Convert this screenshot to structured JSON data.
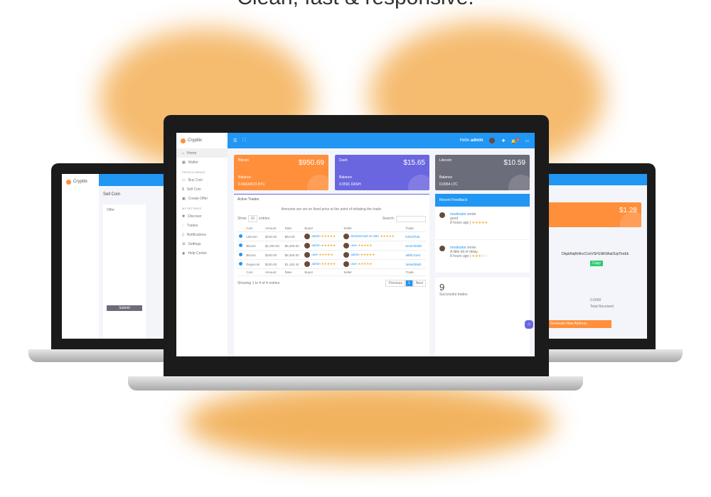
{
  "headline": "Clean, fast & responsive.",
  "colors": {
    "accent": "#2196f3",
    "orange": "#ff8f3a",
    "purple": "#6a66e0",
    "gray": "#6c6d7a"
  },
  "brand": "Cryptlix",
  "topbar": {
    "greeting": "Hello",
    "user": "admin",
    "notif_count": "1"
  },
  "sidebar": {
    "items": [
      {
        "label": "Home",
        "icon": "home-icon"
      },
      {
        "label": "Wallet",
        "icon": "wallet-icon"
      }
    ],
    "section1": "PROFILE MENUS",
    "items2": [
      {
        "label": "Buy Coin"
      },
      {
        "label": "Sell Coin"
      },
      {
        "label": "Create Offer"
      }
    ],
    "section2": "MY SETTINGS",
    "items3": [
      {
        "label": "Discover"
      },
      {
        "label": "Trades"
      },
      {
        "label": "Notifications"
      },
      {
        "label": "Settings"
      },
      {
        "label": "Help Center"
      }
    ]
  },
  "cards": [
    {
      "coin": "Bitcoin",
      "price": "$950.69",
      "label": "Balance",
      "balance": "0.96634573 BTC",
      "color": "#ff8f3a"
    },
    {
      "coin": "Dash",
      "price": "$15.65",
      "label": "Balance",
      "balance": "0.0591 DASH",
      "color": "#6a66e0"
    },
    {
      "coin": "Litecoin",
      "price": "$10.59",
      "label": "Balance",
      "balance": "0.0054 LTC",
      "color": "#6c6d7a"
    }
  ],
  "trades": {
    "title": "Active Trades",
    "note": "Amounts are set on fixed price at the point of initiating the trade.",
    "show": "Show",
    "entries_value": "10",
    "entries": "entries",
    "search": "Search:",
    "headers": [
      "",
      "Coin",
      "Amount",
      "Rate",
      "Buyer",
      "Seller",
      "Trade"
    ],
    "rows": [
      [
        "Litecoin",
        "$100.00",
        "$54.00",
        "admin",
        "Muhammad Ali ABC",
        "b4fe3f7a5"
      ],
      [
        "Bitcoin",
        "$1,000.00",
        "$6,300.00",
        "admin",
        "user",
        "6e4e7b0d8"
      ],
      [
        "Bitcoin",
        "$100.00",
        "$6,300.00",
        "user",
        "admin",
        "a8f0c41e2"
      ],
      [
        "Dogecoin",
        "$100.00",
        "$1,152.42",
        "admin",
        "user",
        "3e5e0b9d1"
      ]
    ],
    "footer": [
      "",
      "Coin",
      "Amount",
      "Rate",
      "Buyer",
      "Seller",
      "Trade"
    ],
    "info": "Showing 1 to 4 of 4 entries",
    "prev": "Previous",
    "page": "1",
    "next": "Next"
  },
  "feedback": {
    "title": "Recent Feedback",
    "items": [
      {
        "user": "moderator",
        "verb": "wrote",
        "text": "good",
        "time": "8 hours ago",
        "stars": 5
      },
      {
        "user": "moderator",
        "verb": "wrote",
        "text": "A little bit of delay",
        "time": "8 hours ago",
        "stars": 3
      }
    ]
  },
  "stat": {
    "value": "9",
    "label": "Successful trades"
  },
  "left": {
    "page": "Sell Coin",
    "button": "Submit",
    "offer": "Offer"
  },
  "right": {
    "price": "$1.28",
    "address": "DhpbNqRrRrvCUnVSH1NKWtaDUpTimEk",
    "copy": "Copy",
    "total": "0.0000",
    "total_label": "Total Received",
    "new_address": "Generate New Address"
  }
}
